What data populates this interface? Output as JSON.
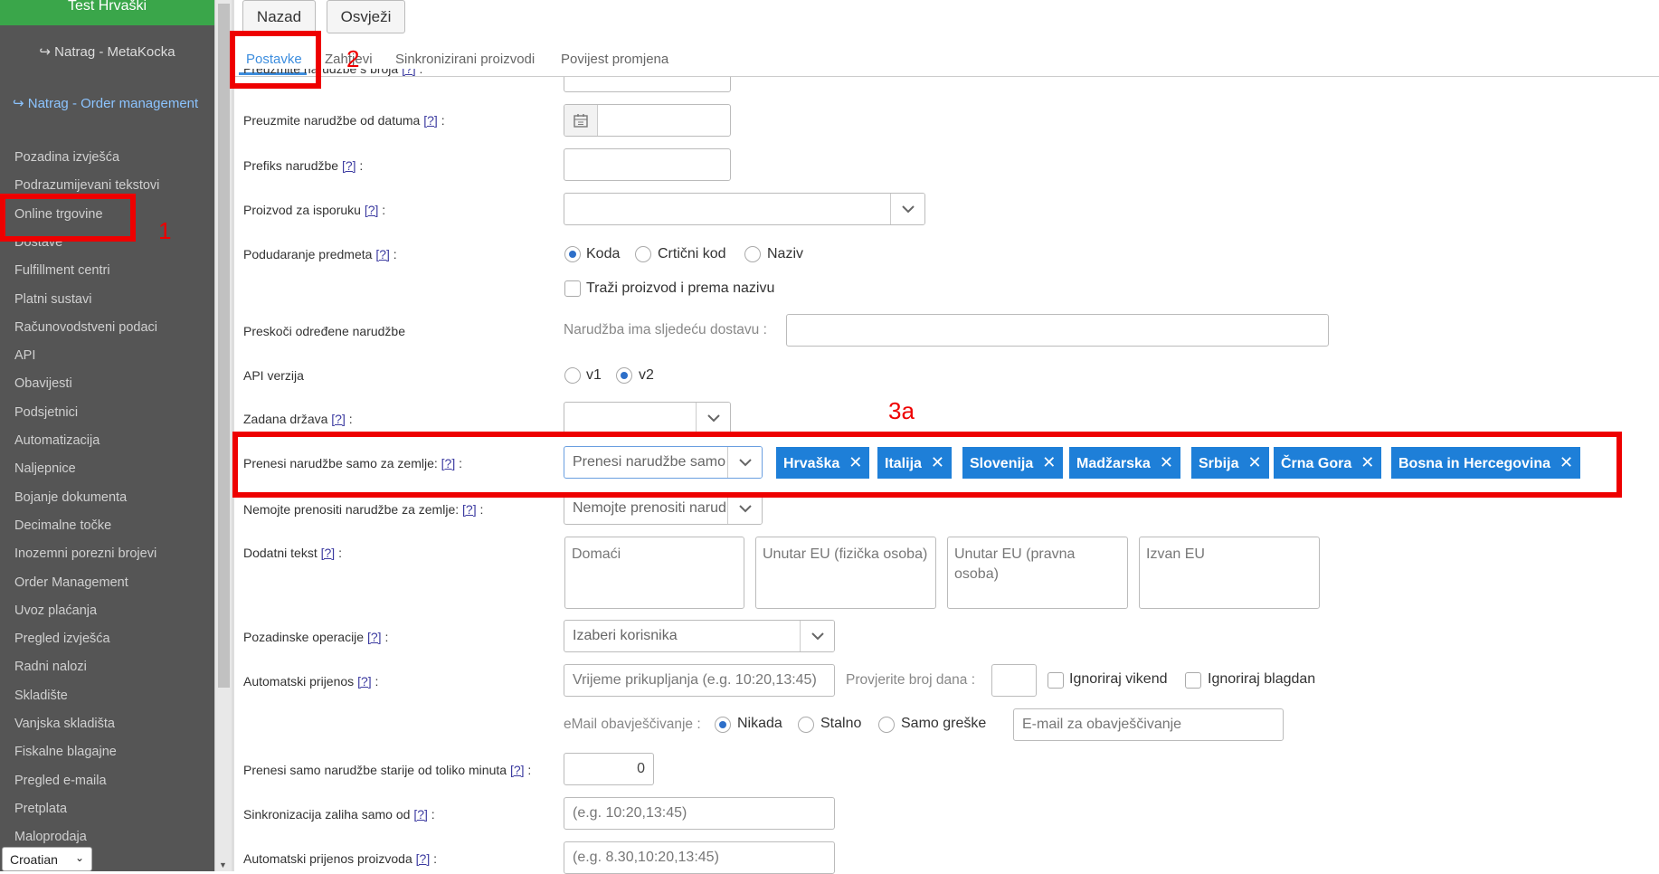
{
  "sidebar": {
    "shop_title": "Test Hrvaški",
    "back_metakocka": "Natrag - MetaKocka",
    "back_order_mgmt": "Natrag - Order management",
    "items": [
      "Pozadina izvješća",
      "Podrazumijevani tekstovi",
      "Online trgovine",
      "Dostave",
      "Fulfillment centri",
      "Platni sustavi",
      "Računovodstveni podaci",
      "API",
      "Obavijesti",
      "Podsjetnici",
      "Automatizacija",
      "Naljepnice",
      "Bojanje dokumenta",
      "Decimalne točke",
      "Inozemni porezni brojevi",
      "Order Management",
      "Uvoz plaćanja",
      "Pregled izvješća",
      "Radni nalozi",
      "Skladište",
      "Vanjska skladišta",
      "Fiskalne blagajne",
      "Pregled e-maila",
      "Pretplata",
      "Maloprodaja"
    ],
    "language": "Croatian"
  },
  "toolbar": {
    "back": "Nazad",
    "refresh": "Osvježi"
  },
  "tabs": [
    "Postavke",
    "Zahtjevi",
    "Sinkronizirani proizvodi",
    "Povijest promjena"
  ],
  "help_marker": "[?]",
  "form": {
    "from_number_label": "Preuzmite narudžbe s broja",
    "from_date_label": "Preuzmite narudžbe od datuma",
    "prefix_label": "Prefiks narudžbe",
    "shipping_product_label": "Proizvod za isporuku",
    "matching_label": "Podudaranje predmeta",
    "matching_options": [
      "Koda",
      "Crtični kod",
      "Naziv"
    ],
    "matching_selected": "Koda",
    "search_by_name": "Traži proizvod i prema nazivu",
    "skip_orders_label": "Preskoči određene narudžbe",
    "skip_orders_sub": "Narudžba ima sljedeću dostavu :",
    "api_version_label": "API verzija",
    "api_options": [
      "v1",
      "v2"
    ],
    "api_selected": "v2",
    "default_country_label": "Zadana država",
    "transfer_countries_label": "Prenesi narudžbe samo za zemlje:",
    "transfer_countries_placeholder": "Prenesi narudžbe samo za zemlje",
    "countries": [
      "Hrvaška",
      "Italija",
      "Slovenija",
      "Madžarska",
      "Srbija",
      "Črna Gora",
      "Bosna in Hercegovina"
    ],
    "no_transfer_label": "Nemojte prenositi narudžbe za zemlje:",
    "no_transfer_placeholder": "Nemojte prenositi narudžbe za zemlje",
    "extra_text_label": "Dodatni tekst",
    "extra_text_fields": [
      "Domaći",
      "Unutar EU (fizička osoba)",
      "Unutar EU (pravna osoba)",
      "Izvan EU"
    ],
    "background_ops_label": "Pozadinske operacije",
    "background_ops_placeholder": "Izaberi korisnika",
    "auto_transfer_label": "Automatski prijenos",
    "auto_transfer_placeholder": "Vrijeme prikupljanja (e.g. 10:20,13:45)",
    "check_days_label": "Provjerite broj dana :",
    "ignore_weekend": "Ignoriraj vikend",
    "ignore_holiday": "Ignoriraj blagdan",
    "email_notify_label": "eMail obavješčivanje :",
    "email_options": [
      "Nikada",
      "Stalno",
      "Samo greške"
    ],
    "email_selected": "Nikada",
    "email_placeholder": "E-mail za obavješčivanje",
    "older_than_label": "Prenesi samo narudžbe starije od toliko minuta",
    "older_than_value": "0",
    "stock_sync_label": "Sinkronizacija zaliha samo od",
    "stock_sync_placeholder": "(e.g. 10:20,13:45)",
    "auto_product_label": "Automatski prijenos proizvoda",
    "auto_product_placeholder": "(e.g. 8.30,10:20,13:45)"
  },
  "annotations": {
    "one": "1",
    "two": "2",
    "three_a": "3a",
    "color": "#ee0000"
  }
}
